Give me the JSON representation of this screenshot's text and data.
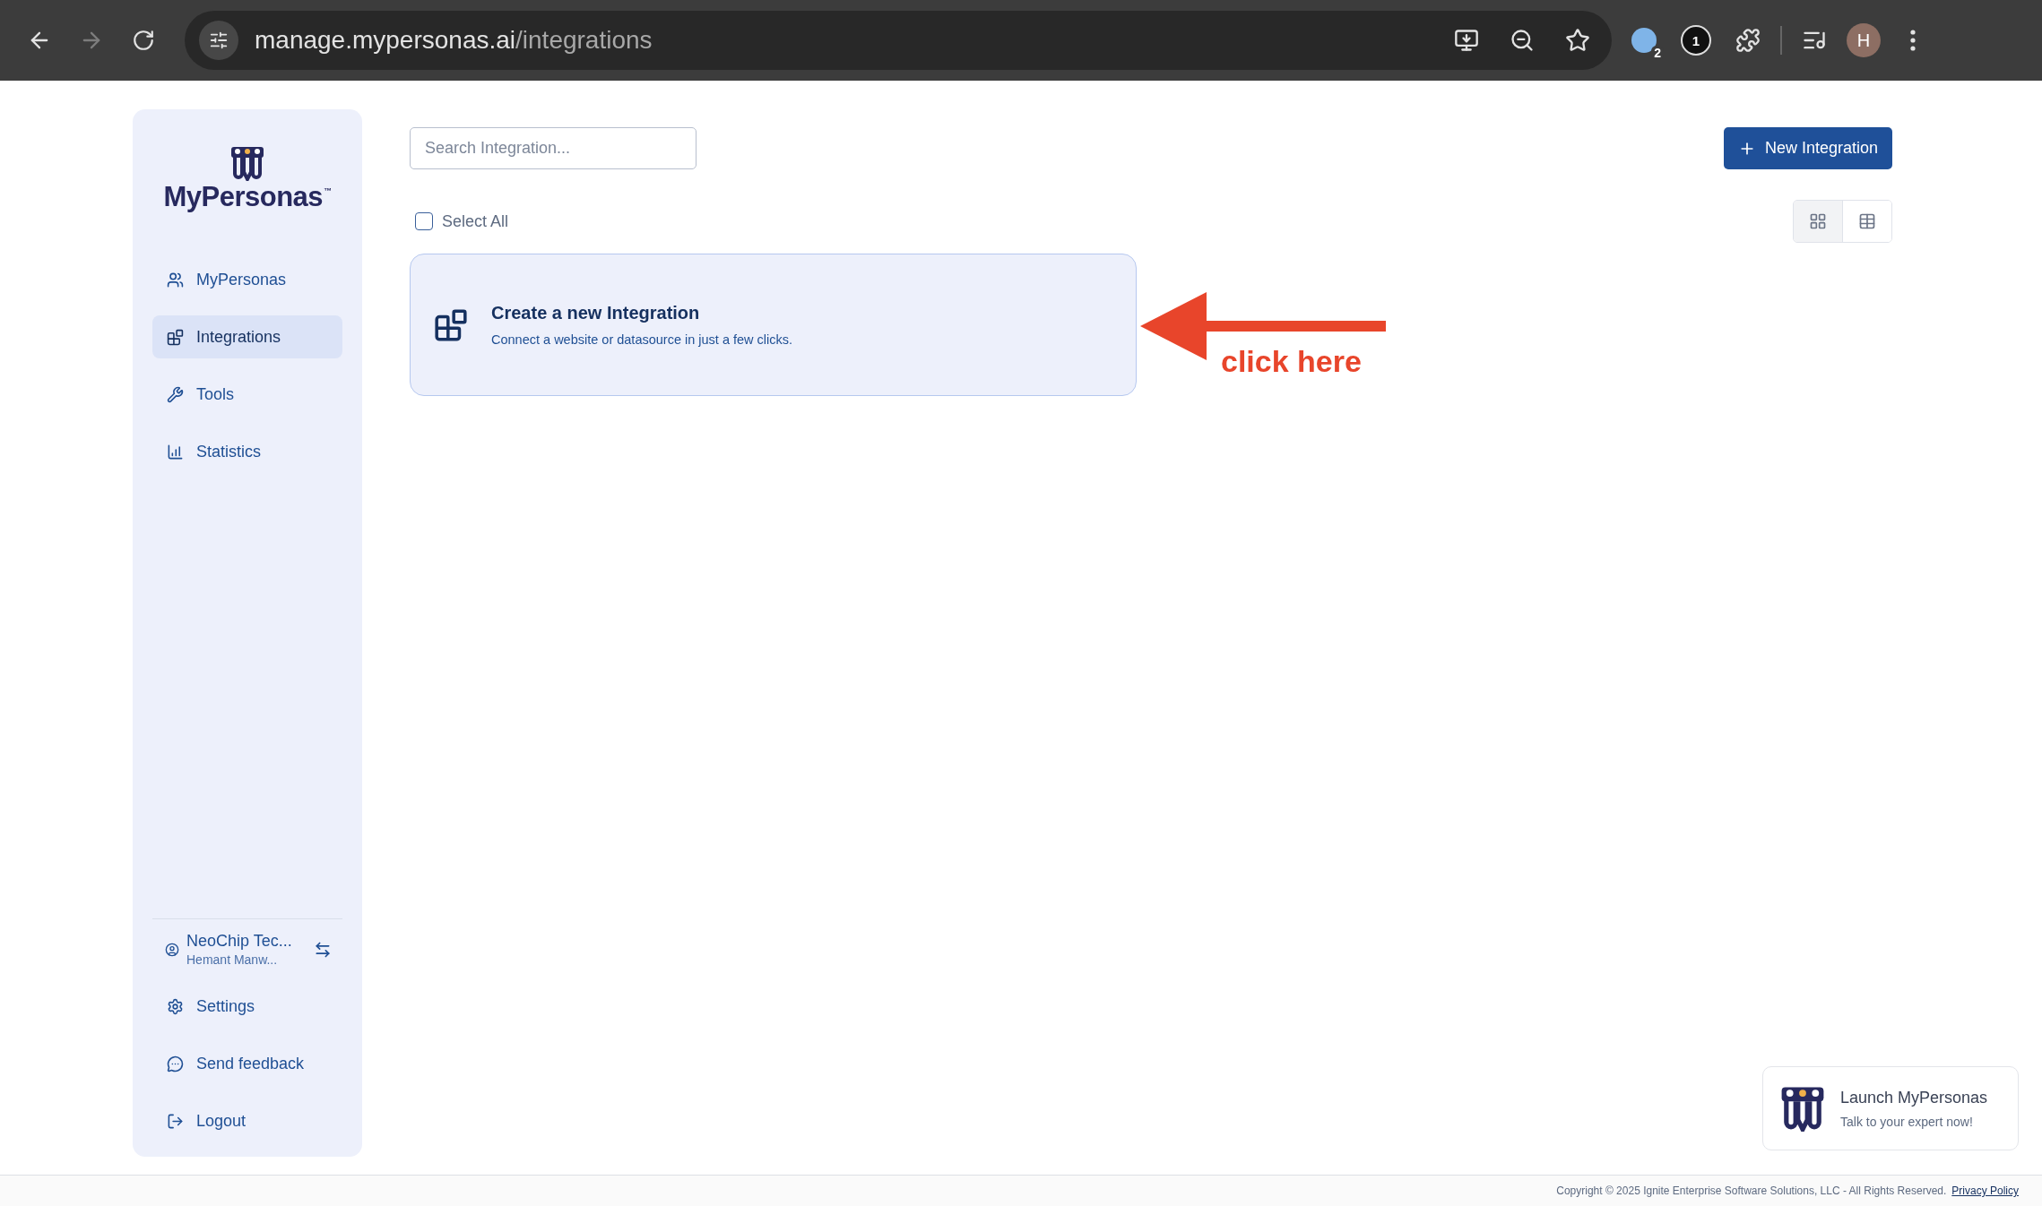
{
  "browser": {
    "url_host": "manage.mypersonas.ai",
    "url_path": "/integrations",
    "extension_badge": "2",
    "extension_count": "1",
    "profile_initial": "H"
  },
  "sidebar": {
    "logo": "MyPersonas",
    "logo_mark": "™",
    "nav": [
      {
        "label": "MyPersonas",
        "selected": false
      },
      {
        "label": "Integrations",
        "selected": true
      },
      {
        "label": "Tools",
        "selected": false
      },
      {
        "label": "Statistics",
        "selected": false
      }
    ],
    "account": {
      "org": "NeoChip Tec...",
      "user": "Hemant Manw..."
    },
    "footer_items": [
      "Settings",
      "Send feedback",
      "Logout"
    ]
  },
  "toolbar": {
    "search": {
      "placeholder": "Search Integration..."
    },
    "new_button": "New Integration",
    "select_all": {
      "label": "Select All",
      "checked": false
    },
    "views": [
      {
        "selected": true
      },
      {
        "selected": false
      }
    ]
  },
  "create_card": {
    "title": "Create a new Integration",
    "subtitle": "Connect a website or datasource in just a few clicks."
  },
  "annotation": {
    "text": "click here"
  },
  "launcher": {
    "title": "Launch MyPersonas",
    "subtitle": "Talk to your expert now!"
  },
  "footer": {
    "copyright": "Copyright © 2025 Ignite Enterprise Software Solutions, LLC - All Rights Reserved.",
    "link": "Privacy Policy"
  }
}
